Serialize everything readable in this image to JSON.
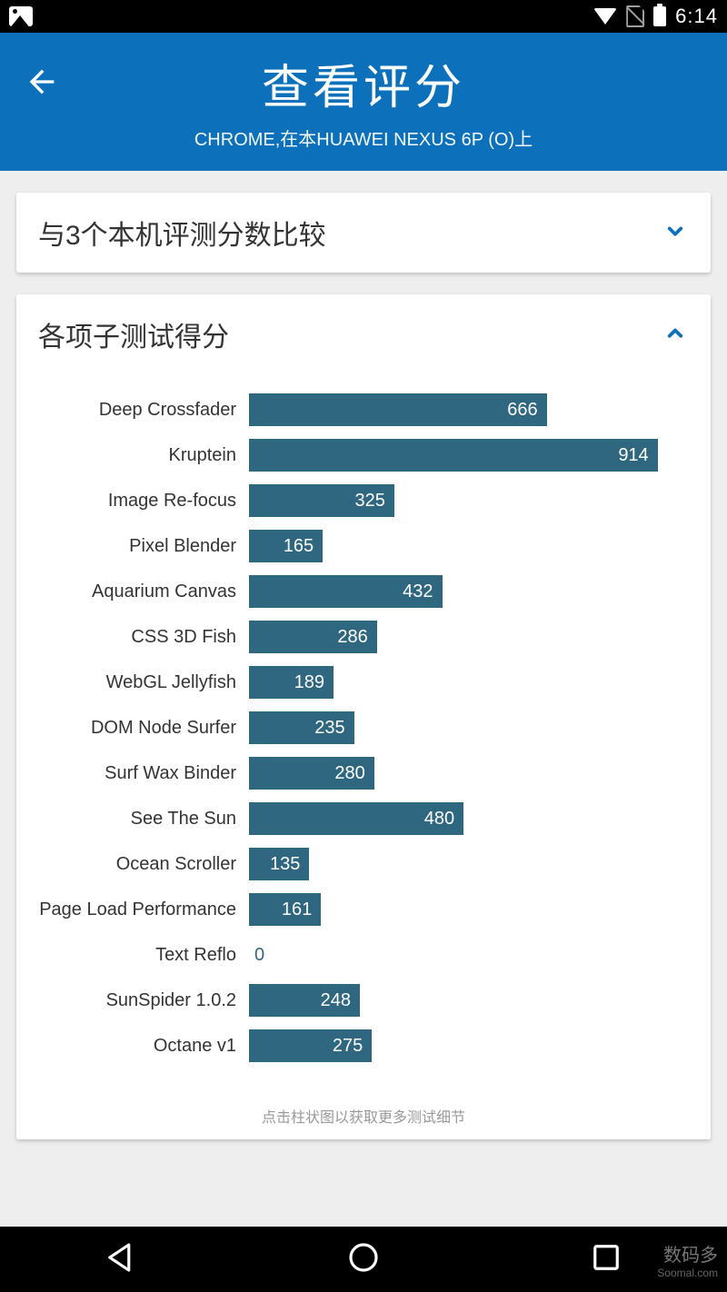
{
  "status": {
    "time": "6:14"
  },
  "header": {
    "title": "查看评分",
    "subtitle": "CHROME,在本HUAWEI NEXUS 6P (O)上"
  },
  "compare_card": {
    "title": "与3个本机评测分数比较"
  },
  "subtests_card": {
    "title": "各项子测试得分",
    "hint": "点击柱状图以获取更多测试细节"
  },
  "chart_data": {
    "type": "bar",
    "title": "各项子测试得分",
    "orientation": "horizontal",
    "xlabel": "",
    "ylabel": "",
    "xlim": [
      0,
      1000
    ],
    "categories": [
      "Deep Crossfader",
      "Kruptein",
      "Image Re-focus",
      "Pixel Blender",
      "Aquarium Canvas",
      "CSS 3D Fish",
      "WebGL Jellyfish",
      "DOM Node Surfer",
      "Surf Wax Binder",
      "See The Sun",
      "Ocean Scroller",
      "Page Load Performance",
      "Text Reflo",
      "SunSpider 1.0.2",
      "Octane v1"
    ],
    "values": [
      666,
      914,
      325,
      165,
      432,
      286,
      189,
      235,
      280,
      480,
      135,
      161,
      0,
      248,
      275
    ],
    "bar_color": "#2f6780"
  },
  "watermark": {
    "line1": "数码多",
    "line2": "Soomal.com"
  }
}
